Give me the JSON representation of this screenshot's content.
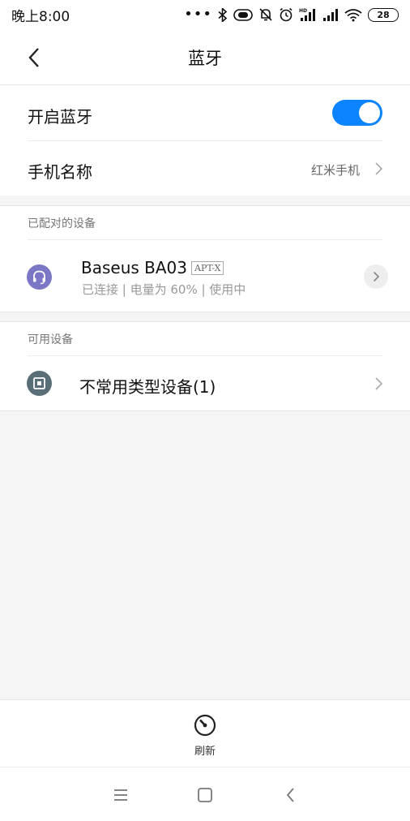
{
  "status_bar": {
    "time": "晚上8:00",
    "dots": "•••",
    "battery": "28",
    "hd_label": "HD"
  },
  "header": {
    "title": "蓝牙"
  },
  "settings": {
    "bluetooth_label": "开启蓝牙",
    "bluetooth_on": true,
    "phone_name_label": "手机名称",
    "phone_name_value": "红米手机"
  },
  "paired": {
    "section_label": "已配对的设备",
    "devices": [
      {
        "name": "Baseus BA03",
        "codec": "APT-X",
        "status": "已连接 | 电量为 60% | 使用中",
        "icon": "headset-icon"
      }
    ]
  },
  "available": {
    "section_label": "可用设备",
    "devices": [
      {
        "name": "不常用类型设备(1)",
        "icon": "device-group-icon"
      }
    ]
  },
  "refresh": {
    "label": "刷新"
  },
  "colors": {
    "accent": "#0d84ff",
    "headset_icon_bg": "#7b76c6",
    "device_icon_bg": "#5a6e78"
  }
}
